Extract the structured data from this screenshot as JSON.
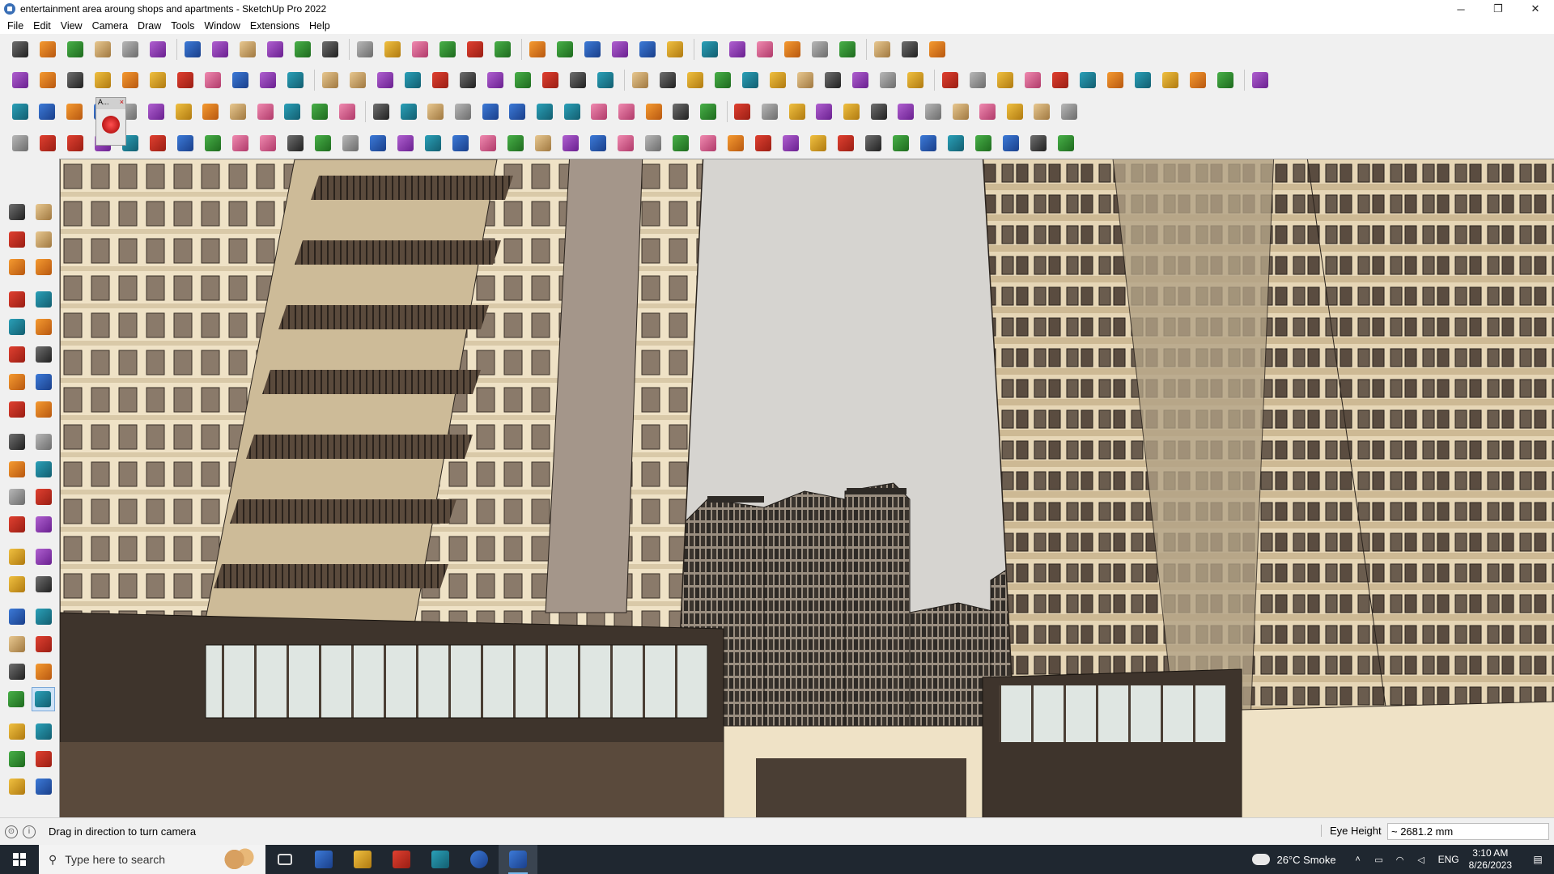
{
  "window": {
    "title": "entertainment area aroung shops and apartments - SketchUp Pro 2022",
    "minimize_glyph": "─",
    "restore_glyph": "❐",
    "close_glyph": "✕"
  },
  "menu": [
    "File",
    "Edit",
    "View",
    "Camera",
    "Draw",
    "Tools",
    "Window",
    "Extensions",
    "Help"
  ],
  "toolbars": {
    "row1_icons": [
      "zoom-extents-icon",
      "select-icon",
      "eraser-icon",
      "pencil-icon",
      "lasso-icon",
      "paint-bucket-icon",
      "push-pull-icon",
      "follow-me-icon",
      "move-icon",
      "rotate-icon",
      "scale-icon",
      "tape-measure-icon",
      "text-icon",
      "paint-icon",
      "orbit-icon",
      "pan-icon",
      "zoom-icon",
      "zoom-window-icon",
      "iso-view-icon",
      "top-view-icon",
      "front-view-icon",
      "right-view-icon",
      "profile-icon",
      "add-location-icon",
      "terrain-icon",
      "flag-icon",
      "up-arrows-icon",
      "down-arrows-icon",
      "section-plane-icon",
      "xray-icon",
      "undo-icon",
      "redo-icon",
      "warehouse-icon"
    ],
    "row2_icons": [
      "box-icon",
      "sphere-icon",
      "component-icon",
      "push-down-icon",
      "extrude-icon",
      "offset-icon",
      "axis-red-icon",
      "axis-green-icon",
      "axis-n-icon",
      "axis-x-icon",
      "axis-f-icon",
      "curve-icon",
      "line-blue-icon",
      "line-purple-icon",
      "line-violet-icon",
      "plane-green-icon",
      "plane-tilt-icon",
      "stair-icon",
      "door-icon",
      "house-icon",
      "roof-icon",
      "window-icon",
      "fence-icon",
      "label-icon",
      "shape-icon",
      "pencil-red-icon",
      "rect-icon",
      "circle-icon",
      "polygon-icon",
      "ellipse-icon",
      "parallelogram-icon",
      "arc-icon",
      "ring-icon",
      "spline-icon",
      "weld-icon",
      "chain-icon",
      "knife-icon",
      "eraser-pink-icon",
      "roof-red-icon",
      "grid-icon",
      "solid-icon",
      "texture-icon",
      "glove-icon",
      "panel-icon",
      "cut-icon"
    ],
    "row3_icons": [
      "layer-blue-icon",
      "layer-blue2-icon",
      "layer-gold-icon",
      "cube-red-icon",
      "plate-icon",
      "curve-orange-icon",
      "square-red-icon",
      "grid-red-icon",
      "page-icon",
      "box-tan-icon",
      "branch-icon",
      "arc-small-icon",
      "path-red-icon",
      "cross-red-icon",
      "cross-green-icon",
      "cross-blue-icon",
      "cone-teal-icon",
      "cone-blue-icon",
      "triangle-gold-icon",
      "loop-gold-icon",
      "spiral-orange-icon",
      "spiral-blue-icon",
      "star-icon",
      "bucket-icon",
      "horseshoe-icon",
      "flow-green-icon",
      "arrows-blue-icon",
      "cubes-red-icon",
      "cubes-pink-icon",
      "grid-gold-icon",
      "box-red-icon",
      "gear-icon",
      "frame-blue-icon",
      "tile-orange-icon",
      "tile-gold-icon",
      "tile-orange2-icon",
      "close-red-icon",
      "curve-dots-icon",
      "grid-dots-icon"
    ],
    "row4_icons": [
      "select-path-icon",
      "spline-red-icon",
      "car-icon",
      "hand-icon",
      "shoe-icon",
      "claw-icon",
      "cube-wire-icon",
      "ball-icon",
      "axe-icon",
      "bracket-icon",
      "bracket2-icon",
      "knife-red-icon",
      "hook-icon",
      "arch-icon",
      "sail-icon",
      "comb-icon",
      "wheel-icon",
      "glove2-icon",
      "leaf-icon",
      "bolt-icon",
      "spring-icon",
      "pen-icon",
      "wing-icon",
      "twin-icon",
      "stair2-icon",
      "truck-icon",
      "stripes-icon",
      "seat-icon",
      "door2-icon",
      "fan-icon",
      "block-icon",
      "fan2-icon",
      "shelf-icon",
      "pillars-icon",
      "sun-icon",
      "flower-icon",
      "stripes2-icon",
      "column-icon",
      "diamond-icon"
    ]
  },
  "floating_toolbar": {
    "label": "A...",
    "close": "×"
  },
  "left_toolbar": [
    "select-arrow-icon",
    "orbit-small-icon",
    "paint-bucket-small-icon",
    "eraser-small-icon",
    "component-small-icon",
    "tape-small-icon",
    "line-tool-icon",
    "freehand-icon",
    "rectangle-tool-icon",
    "rotated-rect-icon",
    "circle-tool-icon",
    "polygon-tool-icon",
    "arc-tool-icon",
    "pie-tool-icon",
    "two-point-arc-icon",
    "three-point-arc-icon",
    "move-tool-icon",
    "push-pull-tool-icon",
    "rotate-tool-icon",
    "follow-me-tool-icon",
    "scale-tool-icon",
    "offset-tool-icon",
    "tape-measure-tool-icon",
    "text-tool-icon",
    "axes-tool-icon",
    "protractor-icon",
    "paint-tool-icon",
    "dimension-icon",
    "orbit-tool-icon",
    "pan-tool-icon",
    "zoom-tool-icon",
    "zoom-window-tool-icon",
    "zoom-extents-tool-icon",
    "previous-view-icon",
    "position-camera-icon",
    "look-around-icon",
    "walk-icon",
    "section-tool-icon",
    "styles-icon",
    "xray-tool-icon",
    "layers-icon",
    "xray-toggle-icon"
  ],
  "status": {
    "message": "Drag in direction to turn camera",
    "measurement_label": "Eye Height",
    "measurement_value": "~ 2681.2 mm"
  },
  "taskbar": {
    "search_placeholder": "Type here to search",
    "weather": "26°C  Smoke",
    "lang": "ENG",
    "time": "3:10 AM",
    "date": "8/26/2023"
  },
  "colors": {
    "sky": "#d6d4d0",
    "facade_cream": "#efe2c6",
    "facade_brown": "#6b5a4a",
    "glass": "#dfe6e2"
  }
}
